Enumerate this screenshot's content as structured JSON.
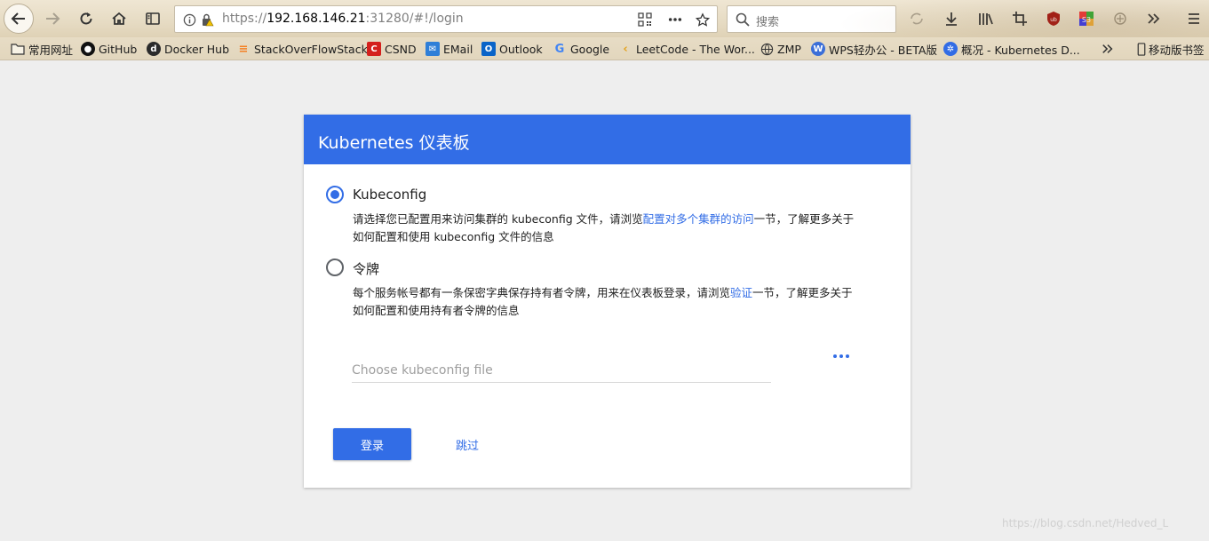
{
  "browser": {
    "url_prefix": "https://",
    "url_host": "192.168.146.21",
    "url_rest": ":31280/#!/login",
    "search_placeholder": "搜索",
    "icons": [
      "back-icon",
      "forward-icon",
      "reload-icon",
      "home-icon",
      "sidebar-icon",
      "info-icon",
      "insecure-lock-icon",
      "qr-code-icon",
      "page-actions-icon",
      "bookmark-star-icon",
      "search-icon",
      "sync-icon",
      "download-icon",
      "library-icon",
      "screenshot-icon",
      "ublock-icon",
      "s3-extension-icon",
      "extension-icon",
      "overflow-icon",
      "menu-icon"
    ]
  },
  "bookmarks": {
    "items": [
      {
        "label": "常用网址",
        "icon": "folder-icon"
      },
      {
        "label": "GitHub",
        "icon": "github-icon"
      },
      {
        "label": "Docker Hub",
        "icon": "docker-icon"
      },
      {
        "label": "StackOverFlowStack",
        "icon": "stackoverflow-icon"
      },
      {
        "label": "CSND",
        "icon": "csdn-icon"
      },
      {
        "label": "EMail",
        "icon": "email-icon"
      },
      {
        "label": "Outlook",
        "icon": "outlook-icon"
      },
      {
        "label": "Google",
        "icon": "google-icon"
      },
      {
        "label": "LeetCode - The Wor...",
        "icon": "leetcode-icon"
      },
      {
        "label": "ZMP",
        "icon": "globe-icon"
      },
      {
        "label": "WPS轻办公 - BETA版",
        "icon": "wps-icon"
      },
      {
        "label": "概况 - Kubernetes D...",
        "icon": "kubernetes-icon"
      }
    ],
    "mobile_label": "移动版书签"
  },
  "dashboard": {
    "title": "Kubernetes 仪表板",
    "kubeconfig": {
      "label": "Kubeconfig",
      "checked": true,
      "desc_before": "请选择您已配置用来访问集群的 kubeconfig 文件，请浏览",
      "desc_link": "配置对多个集群的访问",
      "desc_after": "一节，了解更多关于如何配置和使用 kubeconfig 文件的信息"
    },
    "token": {
      "label": "令牌",
      "checked": false,
      "desc_before": "每个服务帐号都有一条保密字典保存持有者令牌，用来在仪表板登录，请浏览",
      "desc_link": "验证",
      "desc_after": "一节，了解更多关于如何配置和使用持有者令牌的信息"
    },
    "file_placeholder": "Choose kubeconfig file",
    "login_label": "登录",
    "skip_label": "跳过"
  },
  "watermark": "https://blog.csdn.net/Hedved_L",
  "colors": {
    "accent": "#326de6",
    "toolbar": "#e6dbc3",
    "page_bg": "#eeeeee"
  }
}
